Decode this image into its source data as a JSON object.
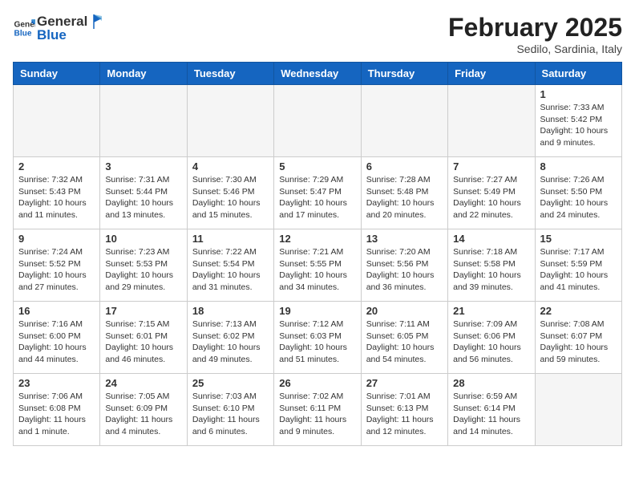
{
  "header": {
    "logo_general": "General",
    "logo_blue": "Blue",
    "month_title": "February 2025",
    "subtitle": "Sedilo, Sardinia, Italy"
  },
  "weekdays": [
    "Sunday",
    "Monday",
    "Tuesday",
    "Wednesday",
    "Thursday",
    "Friday",
    "Saturday"
  ],
  "weeks": [
    [
      {
        "day": "",
        "info": ""
      },
      {
        "day": "",
        "info": ""
      },
      {
        "day": "",
        "info": ""
      },
      {
        "day": "",
        "info": ""
      },
      {
        "day": "",
        "info": ""
      },
      {
        "day": "",
        "info": ""
      },
      {
        "day": "1",
        "info": "Sunrise: 7:33 AM\nSunset: 5:42 PM\nDaylight: 10 hours and 9 minutes."
      }
    ],
    [
      {
        "day": "2",
        "info": "Sunrise: 7:32 AM\nSunset: 5:43 PM\nDaylight: 10 hours and 11 minutes."
      },
      {
        "day": "3",
        "info": "Sunrise: 7:31 AM\nSunset: 5:44 PM\nDaylight: 10 hours and 13 minutes."
      },
      {
        "day": "4",
        "info": "Sunrise: 7:30 AM\nSunset: 5:46 PM\nDaylight: 10 hours and 15 minutes."
      },
      {
        "day": "5",
        "info": "Sunrise: 7:29 AM\nSunset: 5:47 PM\nDaylight: 10 hours and 17 minutes."
      },
      {
        "day": "6",
        "info": "Sunrise: 7:28 AM\nSunset: 5:48 PM\nDaylight: 10 hours and 20 minutes."
      },
      {
        "day": "7",
        "info": "Sunrise: 7:27 AM\nSunset: 5:49 PM\nDaylight: 10 hours and 22 minutes."
      },
      {
        "day": "8",
        "info": "Sunrise: 7:26 AM\nSunset: 5:50 PM\nDaylight: 10 hours and 24 minutes."
      }
    ],
    [
      {
        "day": "9",
        "info": "Sunrise: 7:24 AM\nSunset: 5:52 PM\nDaylight: 10 hours and 27 minutes."
      },
      {
        "day": "10",
        "info": "Sunrise: 7:23 AM\nSunset: 5:53 PM\nDaylight: 10 hours and 29 minutes."
      },
      {
        "day": "11",
        "info": "Sunrise: 7:22 AM\nSunset: 5:54 PM\nDaylight: 10 hours and 31 minutes."
      },
      {
        "day": "12",
        "info": "Sunrise: 7:21 AM\nSunset: 5:55 PM\nDaylight: 10 hours and 34 minutes."
      },
      {
        "day": "13",
        "info": "Sunrise: 7:20 AM\nSunset: 5:56 PM\nDaylight: 10 hours and 36 minutes."
      },
      {
        "day": "14",
        "info": "Sunrise: 7:18 AM\nSunset: 5:58 PM\nDaylight: 10 hours and 39 minutes."
      },
      {
        "day": "15",
        "info": "Sunrise: 7:17 AM\nSunset: 5:59 PM\nDaylight: 10 hours and 41 minutes."
      }
    ],
    [
      {
        "day": "16",
        "info": "Sunrise: 7:16 AM\nSunset: 6:00 PM\nDaylight: 10 hours and 44 minutes."
      },
      {
        "day": "17",
        "info": "Sunrise: 7:15 AM\nSunset: 6:01 PM\nDaylight: 10 hours and 46 minutes."
      },
      {
        "day": "18",
        "info": "Sunrise: 7:13 AM\nSunset: 6:02 PM\nDaylight: 10 hours and 49 minutes."
      },
      {
        "day": "19",
        "info": "Sunrise: 7:12 AM\nSunset: 6:03 PM\nDaylight: 10 hours and 51 minutes."
      },
      {
        "day": "20",
        "info": "Sunrise: 7:11 AM\nSunset: 6:05 PM\nDaylight: 10 hours and 54 minutes."
      },
      {
        "day": "21",
        "info": "Sunrise: 7:09 AM\nSunset: 6:06 PM\nDaylight: 10 hours and 56 minutes."
      },
      {
        "day": "22",
        "info": "Sunrise: 7:08 AM\nSunset: 6:07 PM\nDaylight: 10 hours and 59 minutes."
      }
    ],
    [
      {
        "day": "23",
        "info": "Sunrise: 7:06 AM\nSunset: 6:08 PM\nDaylight: 11 hours and 1 minute."
      },
      {
        "day": "24",
        "info": "Sunrise: 7:05 AM\nSunset: 6:09 PM\nDaylight: 11 hours and 4 minutes."
      },
      {
        "day": "25",
        "info": "Sunrise: 7:03 AM\nSunset: 6:10 PM\nDaylight: 11 hours and 6 minutes."
      },
      {
        "day": "26",
        "info": "Sunrise: 7:02 AM\nSunset: 6:11 PM\nDaylight: 11 hours and 9 minutes."
      },
      {
        "day": "27",
        "info": "Sunrise: 7:01 AM\nSunset: 6:13 PM\nDaylight: 11 hours and 12 minutes."
      },
      {
        "day": "28",
        "info": "Sunrise: 6:59 AM\nSunset: 6:14 PM\nDaylight: 11 hours and 14 minutes."
      },
      {
        "day": "",
        "info": ""
      }
    ]
  ]
}
